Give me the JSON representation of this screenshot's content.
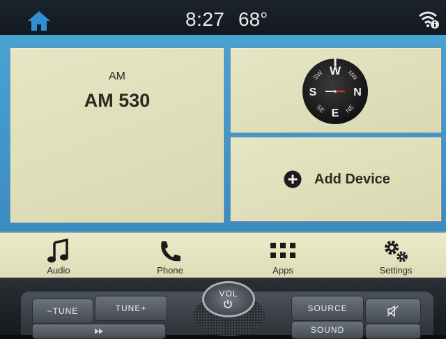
{
  "status_bar": {
    "time": "8:27",
    "temperature": "68°",
    "icons": [
      "home-icon",
      "wifi-info-icon"
    ]
  },
  "radio_tile": {
    "band": "AM",
    "station": "AM 530"
  },
  "compass_tile": {
    "directions": {
      "north": "N",
      "northeast": "NE",
      "east": "E",
      "southeast": "SE",
      "south": "S",
      "southwest": "SW",
      "west": "W",
      "northwest": "NW"
    },
    "icon": "compass-icon"
  },
  "device_tile": {
    "label": "Add Device",
    "icon": "plus-circle-icon"
  },
  "nav": {
    "items": [
      {
        "label": "Audio",
        "icon": "music-note-icon"
      },
      {
        "label": "Phone",
        "icon": "phone-handset-icon"
      },
      {
        "label": "Apps",
        "icon": "apps-grid-icon"
      },
      {
        "label": "Settings",
        "icon": "gears-icon"
      }
    ]
  },
  "hardware": {
    "tune_down": "−TUNE",
    "tune_up": "TUNE+",
    "volume": "VOL",
    "source": "SOURCE",
    "sound": "SOUND"
  },
  "colors": {
    "panel_blue": "#4aa2d4",
    "tile_cream": "#e6e6c4",
    "home_icon_blue": "#2f8fd6",
    "compass_needle_red": "#d42a1f"
  }
}
